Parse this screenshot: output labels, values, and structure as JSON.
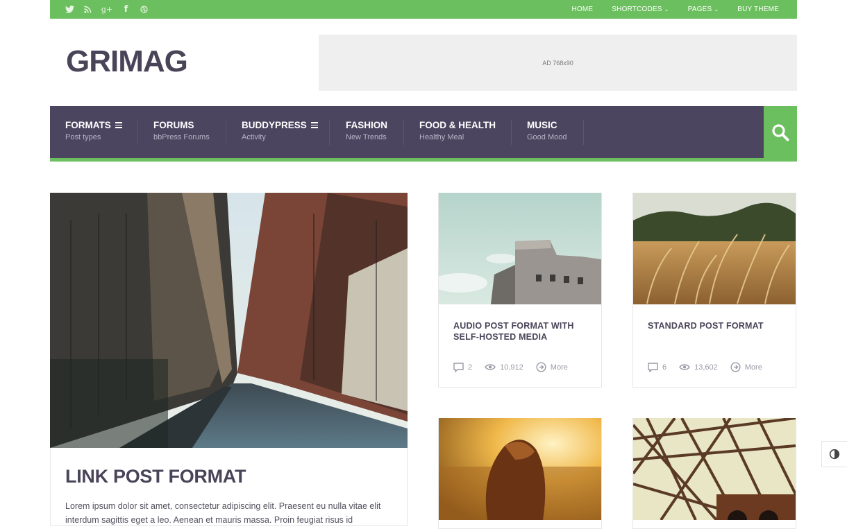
{
  "topbar": {
    "social_icons": [
      "twitter-icon",
      "rss-icon",
      "google-plus-icon",
      "facebook-icon",
      "dribbble-icon"
    ],
    "nav": [
      {
        "label": "HOME",
        "dropdown": false
      },
      {
        "label": "SHORTCODES",
        "dropdown": true
      },
      {
        "label": "PAGES",
        "dropdown": true
      },
      {
        "label": "BUY THEME",
        "dropdown": false
      }
    ]
  },
  "header": {
    "logo": "GRIMAG",
    "ad_label": "AD 768x90"
  },
  "mainnav": {
    "items": [
      {
        "title": "FORMATS",
        "subtitle": "Post types",
        "menu": true
      },
      {
        "title": "FORUMS",
        "subtitle": "bbPress Forums",
        "menu": false
      },
      {
        "title": "BUDDYPRESS",
        "subtitle": "Activity",
        "menu": true
      },
      {
        "title": "FASHION",
        "subtitle": "New Trends",
        "menu": false
      },
      {
        "title": "FOOD & HEALTH",
        "subtitle": "Healthy Meal",
        "menu": false
      },
      {
        "title": "MUSIC",
        "subtitle": "Good Mood",
        "menu": false
      }
    ],
    "search_icon": "search-icon"
  },
  "featured": {
    "title": "LINK POST FORMAT",
    "excerpt": "Lorem ipsum dolor sit amet, consectetur adipiscing elit. Praesent eu nulla vitae elit interdum sagittis eget a leo. Aenean et mauris massa. Proin feugiat risus id"
  },
  "posts": [
    {
      "title": "AUDIO POST FORMAT WITH SELF-HOSTED MEDIA",
      "comments": "2",
      "views": "10,912",
      "more": "More"
    },
    {
      "title": "STANDARD POST FORMAT",
      "comments": "6",
      "views": "13,602",
      "more": "More"
    }
  ],
  "colors": {
    "accent": "#6cbf5e",
    "nav_bg": "#4b4560",
    "text": "#4a4459"
  }
}
